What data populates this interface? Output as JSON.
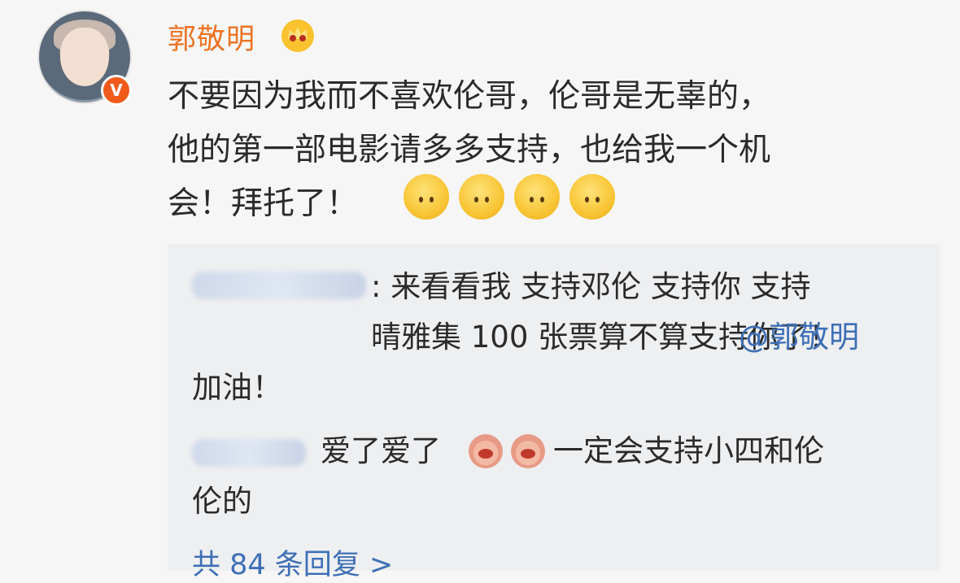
{
  "post": {
    "username": "郭敬明",
    "verified_badge": "V",
    "text": "不要因为我而不喜欢伦哥，伦哥是无辜的，\n他的第一部电影请多多支持，也给我一个机\n会！拜托了！",
    "emojis": [
      "smile-emoji",
      "smile-emoji",
      "smile-emoji",
      "smile-emoji"
    ]
  },
  "replies": {
    "items": [
      {
        "text": ": 来看看我 支持邓伦 支持你 支持\n晴雅集 100 张票算不算支持你了！",
        "mention": "@郭敬明",
        "text_end": "加油！"
      },
      {
        "text_before": "爱了爱了",
        "emojis": [
          "pig-emoji",
          "pig-emoji"
        ],
        "text_after": "一定会支持小四和伦\n伦的"
      }
    ],
    "count_label": "共 84 条回复 >"
  },
  "colors": {
    "username": "#ec7322",
    "link": "#3e6fb6",
    "badge": "#f05a1a"
  }
}
